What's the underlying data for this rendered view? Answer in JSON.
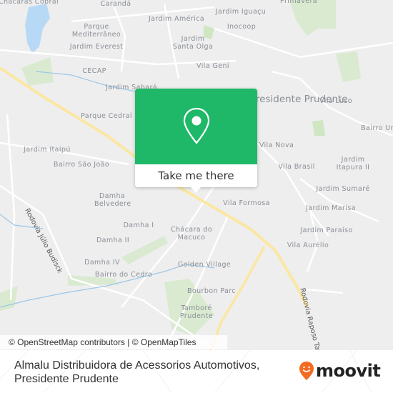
{
  "map": {
    "labels": [
      {
        "text": "Chácaras Cobral"
      },
      {
        "text": "Carandá"
      },
      {
        "text": "Primavera"
      },
      {
        "text": "Jardim América"
      },
      {
        "text": "Jardim Iguaçu"
      },
      {
        "text": "Parque Mediterrâneo"
      },
      {
        "text": "Inocoop"
      },
      {
        "text": "Jardim Santa Olga"
      },
      {
        "text": "Jardim Everest"
      },
      {
        "text": "CECAP"
      },
      {
        "text": "Vila Geni"
      },
      {
        "text": "Jardim Sabará"
      },
      {
        "text": "Presidente Prudente"
      },
      {
        "text": "Vila Luso"
      },
      {
        "text": "Parque Cedral"
      },
      {
        "text": "Bairro Ur"
      },
      {
        "text": "Jardim Itaipú"
      },
      {
        "text": "Vila Nova"
      },
      {
        "text": "Bairro São João"
      },
      {
        "text": "Vila Brasil"
      },
      {
        "text": "Jardim Itapura II"
      },
      {
        "text": "Damha Belvedere"
      },
      {
        "text": "Jardim Sumaré"
      },
      {
        "text": "Vila Formosa"
      },
      {
        "text": "Jardim Marisa"
      },
      {
        "text": "Damha I"
      },
      {
        "text": "Chácara do Macuco"
      },
      {
        "text": "Jardim Paraíso"
      },
      {
        "text": "Damha II"
      },
      {
        "text": "Vila Aurélio"
      },
      {
        "text": "Damha IV"
      },
      {
        "text": "Golden Village"
      },
      {
        "text": "Bairro do Cedro"
      },
      {
        "text": "Bourbon Parc"
      },
      {
        "text": "Tamboré Prudente"
      }
    ],
    "roads": [
      {
        "text": "Rodovia Júlio Budisck"
      },
      {
        "text": "Rodovia Raposo Tavares"
      }
    ],
    "attribution": "© OpenStreetMap contributors | © OpenMapTiles"
  },
  "popup": {
    "icon": "map-pin-icon",
    "button_label": "Take me there",
    "color": "#1fb868"
  },
  "footer": {
    "title_line1": "Almalu Distribuidora de Acessorios Automotivos,",
    "title_line2": "Presidente Prudente",
    "brand": "moovit",
    "brand_color": "#f26b21"
  }
}
